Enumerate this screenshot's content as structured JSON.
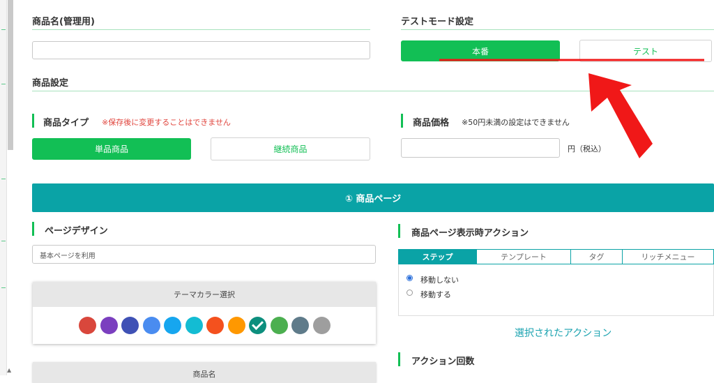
{
  "product_name": {
    "label": "商品名(管理用)",
    "value": ""
  },
  "test_mode": {
    "label": "テストモード設定",
    "production_label": "本番",
    "test_label": "テスト"
  },
  "product_settings": {
    "label": "商品設定"
  },
  "product_type": {
    "label": "商品タイプ",
    "note": "※保存後に変更することはできません",
    "single_label": "単品商品",
    "recurring_label": "継続商品"
  },
  "product_price": {
    "label": "商品価格",
    "note": "※50円未満の設定はできません",
    "value": "",
    "unit": "円（税込）"
  },
  "page_banner": {
    "label": "① 商品ページ"
  },
  "page_design": {
    "label": "ページデザイン",
    "selected": "基本ページを利用"
  },
  "theme_color": {
    "title": "テーマカラー選択",
    "colors": [
      "#d9473c",
      "#7b3fbf",
      "#3f51b5",
      "#4a8cf0",
      "#16a6ef",
      "#13bcd3",
      "#f4511e",
      "#ff9800",
      "#0d8f7e",
      "#4caf50",
      "#5f7b8a",
      "#9e9e9e"
    ],
    "selected_index": 8
  },
  "product_name_section": {
    "label": "商品名"
  },
  "page_action": {
    "label": "商品ページ表示時アクション",
    "tabs": [
      "ステップ",
      "テンプレート",
      "タグ",
      "リッチメニュー"
    ],
    "active_tab": 0,
    "options": [
      "移動しない",
      "移動する"
    ],
    "selected_option": 0,
    "selected_action_label": "選択されたアクション"
  },
  "action_count": {
    "label": "アクション回数"
  },
  "annotation": {
    "arrow_color": "#f01818",
    "underline_color": "#f01818"
  }
}
